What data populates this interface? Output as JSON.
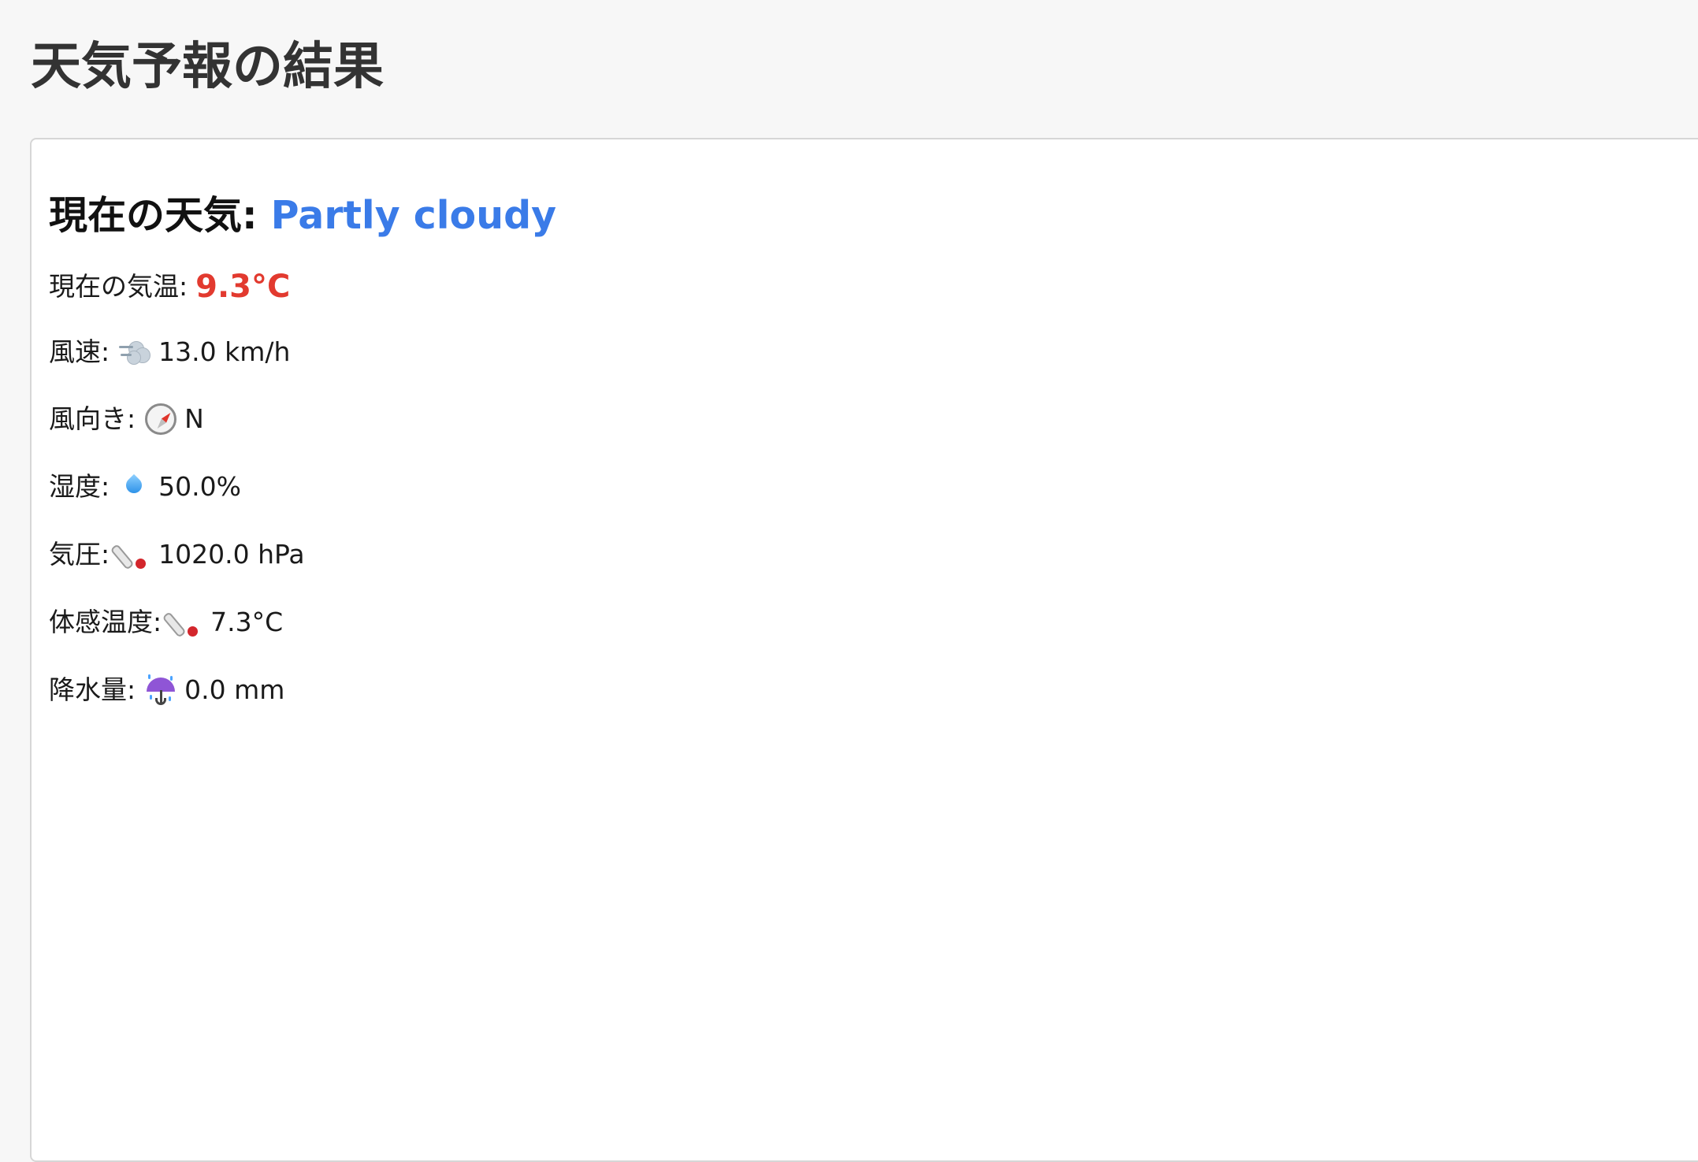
{
  "page": {
    "title": "天気予報の結果"
  },
  "current": {
    "heading_label": "現在の天気:",
    "condition": "Partly cloudy",
    "temperature_label": "現在の気温:",
    "temperature_value": "9.3°C"
  },
  "details": {
    "wind_speed_label": "風速:",
    "wind_speed_value": "13.0 km/h",
    "wind_direction_label": "風向き:",
    "wind_direction_value": "N",
    "humidity_label": "湿度:",
    "humidity_value": "50.0%",
    "pressure_label": "気圧:",
    "pressure_value": "1020.0 hPa",
    "feels_like_label": "体感温度:",
    "feels_like_value": "7.3°C",
    "precipitation_label": "降水量:",
    "precipitation_value": "0.0 mm"
  },
  "icons": {
    "wind_speed": "wind-icon",
    "wind_direction": "compass-icon",
    "humidity": "droplet-icon",
    "pressure": "thermometer-icon",
    "feels_like": "thermometer-icon",
    "precipitation": "umbrella-rain-icon"
  },
  "colors": {
    "condition": "#3a7be8",
    "temperature": "#e23a2f",
    "title": "#333333",
    "background": "#f7f7f7",
    "card": "#ffffff"
  }
}
